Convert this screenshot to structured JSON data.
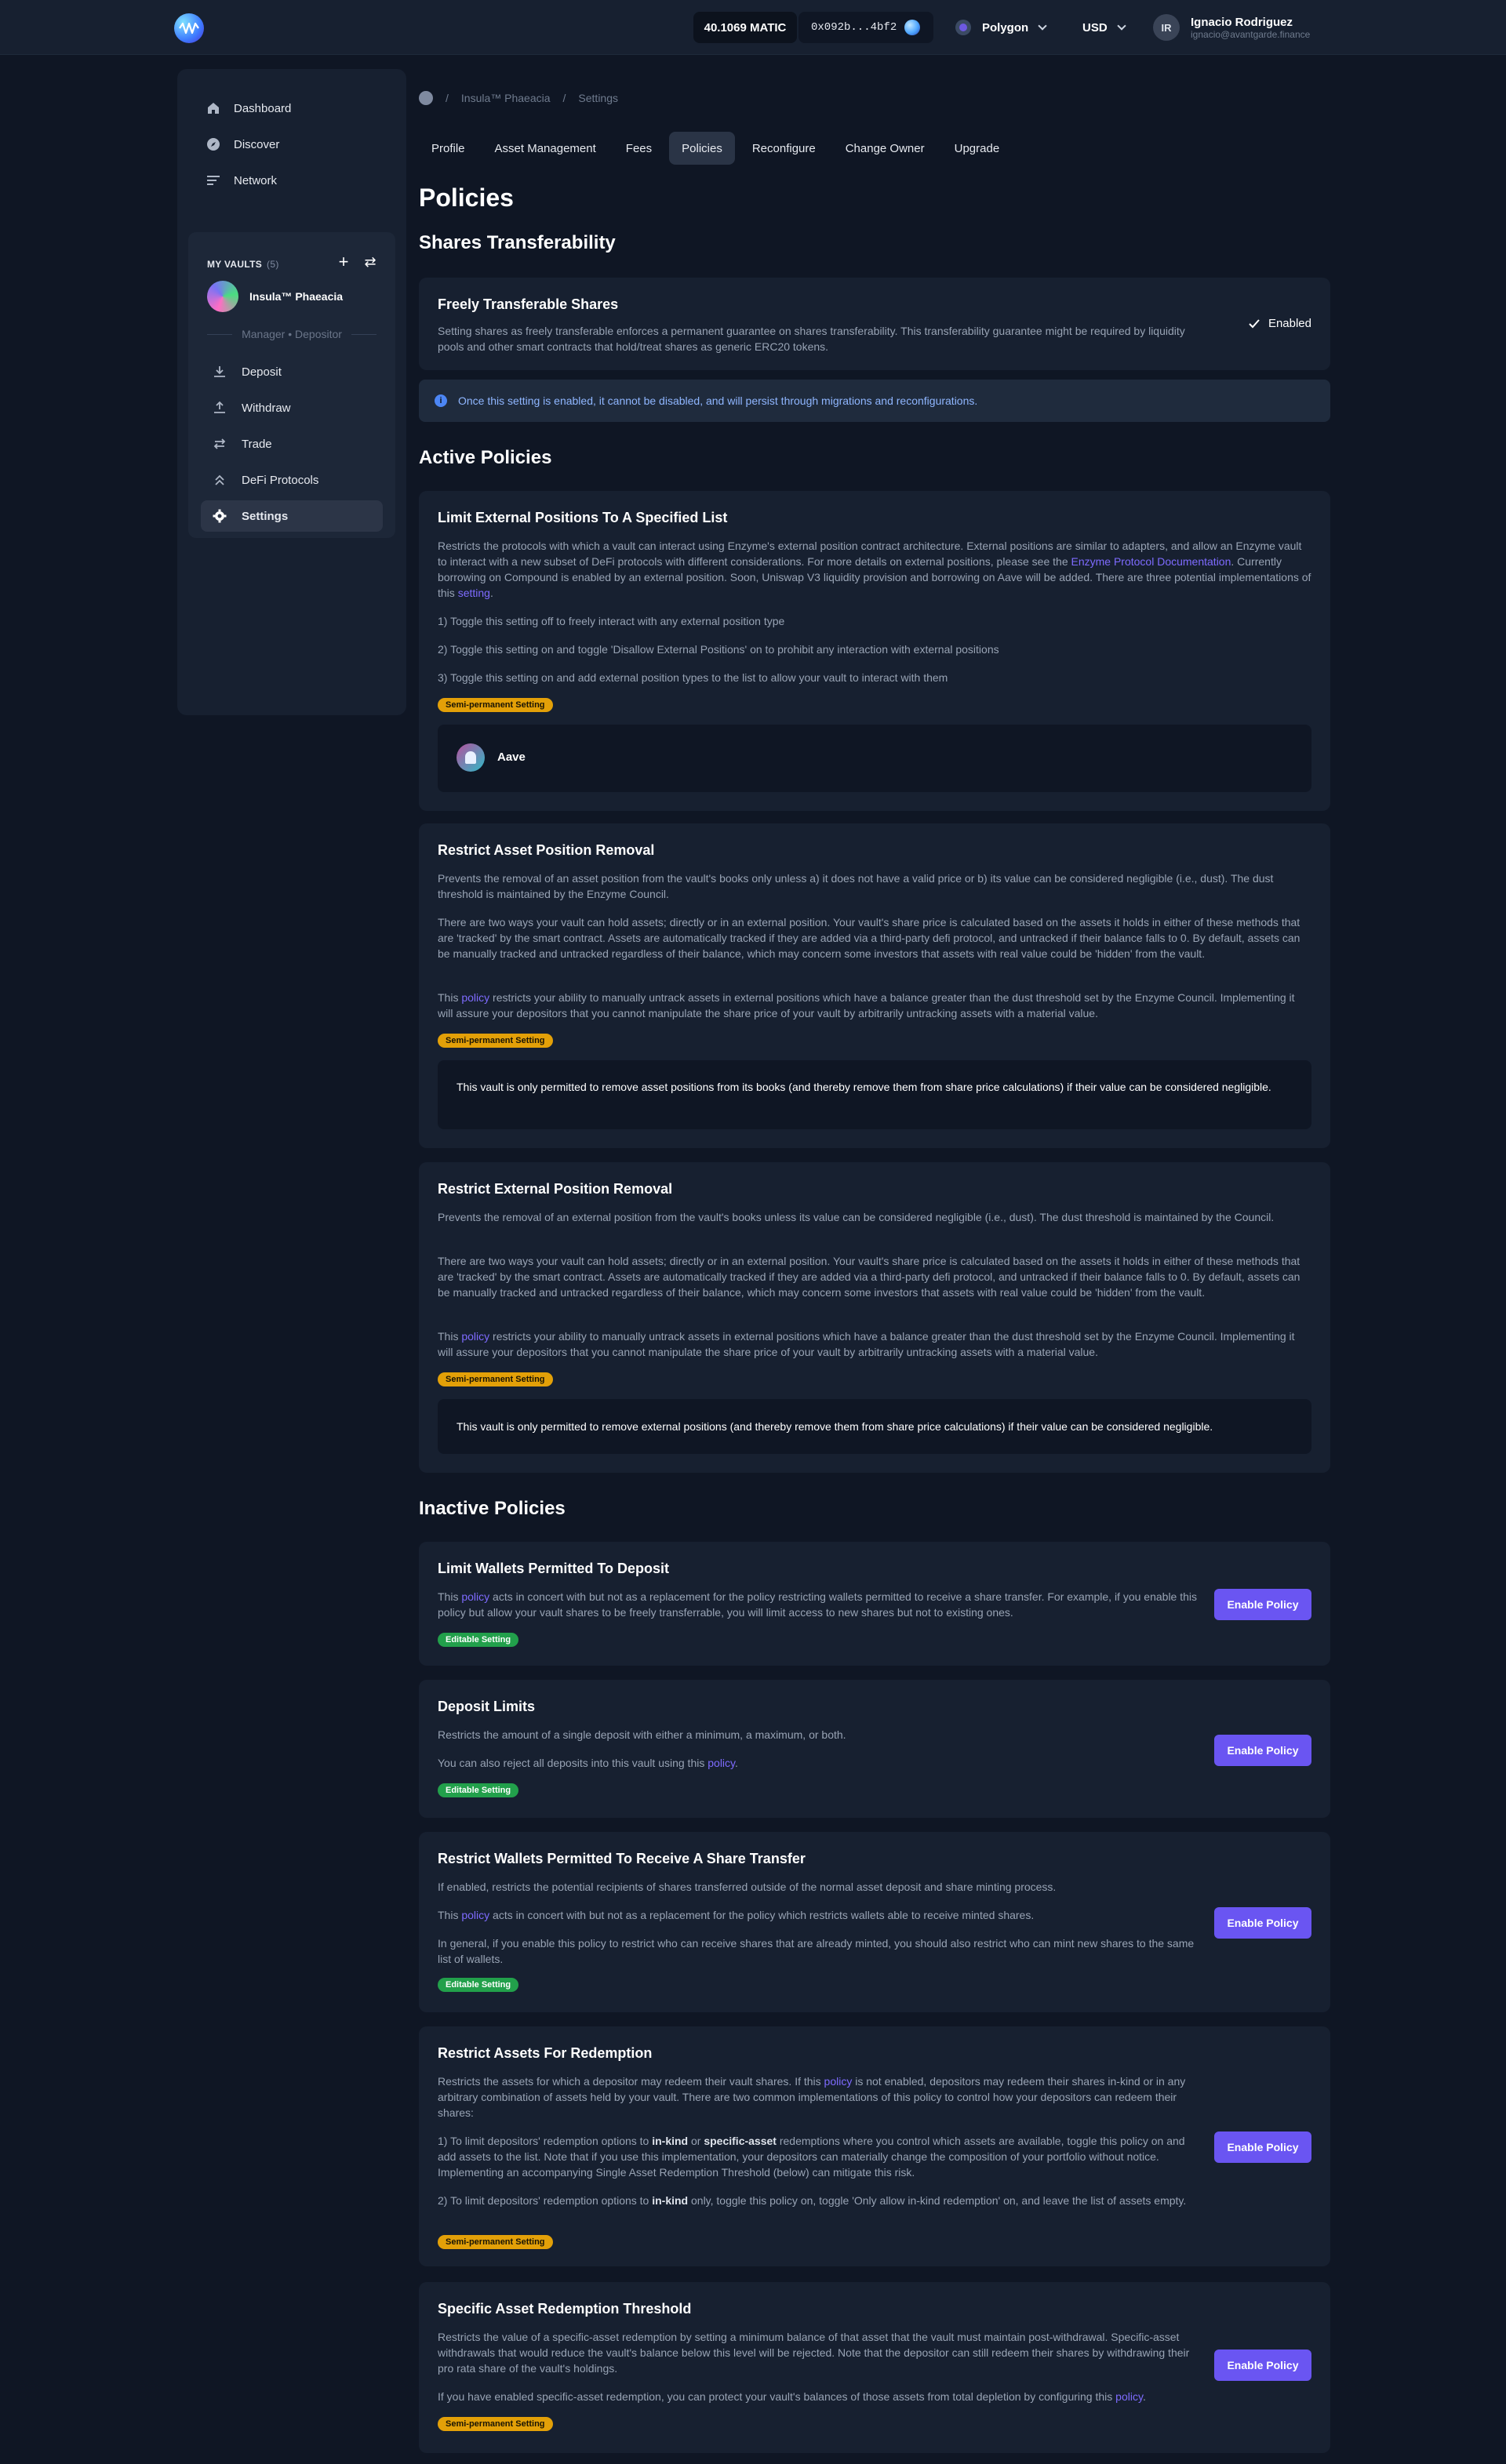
{
  "topbar": {
    "balance": "40.1069 MATIC",
    "address": "0x092b...4bf2",
    "network": "Polygon",
    "currency": "USD",
    "user_initials": "IR",
    "user_name": "Ignacio Rodriguez",
    "user_email": "ignacio@avantgarde.finance"
  },
  "sidebar": {
    "nav": [
      {
        "label": "Dashboard",
        "icon": "home-icon"
      },
      {
        "label": "Discover",
        "icon": "compass-icon"
      },
      {
        "label": "Network",
        "icon": "list-icon"
      }
    ],
    "vaults_title": "MY VAULTS",
    "vaults_count": "(5)",
    "vault_name": "Insula™ Phaeacia",
    "vault_role": "Manager • Depositor",
    "vault_items": [
      {
        "label": "Deposit",
        "icon": "download-icon"
      },
      {
        "label": "Withdraw",
        "icon": "upload-icon"
      },
      {
        "label": "Trade",
        "icon": "swap-icon"
      },
      {
        "label": "DeFi Protocols",
        "icon": "chevrons-up-icon"
      },
      {
        "label": "Settings",
        "icon": "gear-icon"
      }
    ]
  },
  "breadcrumb": [
    "Insula™ Phaeacia",
    "Settings"
  ],
  "tabs": [
    "Profile",
    "Asset Management",
    "Fees",
    "Policies",
    "Reconfigure",
    "Change Owner",
    "Upgrade"
  ],
  "page_title": "Policies",
  "shares_transferability": {
    "section_title": "Shares Transferability",
    "card_title": "Freely Transferable Shares",
    "card_text": "Setting shares as freely transferable enforces a permanent guarantee on shares transferability. This transferability guarantee might be required by liquidity pools and other smart contracts that hold/treat shares as generic ERC20 tokens.",
    "status": "Enabled",
    "info": "Once this setting is enabled, it cannot be disabled, and will persist through migrations and reconfigurations."
  },
  "active": {
    "section_title": "Active Policies",
    "limit_external": {
      "title": "Limit External Positions To A Specified List",
      "text1_a": "Restricts the protocols with which a vault can interact using Enzyme's external position contract architecture. External positions are similar to adapters, and allow an Enzyme vault to interact with a new subset of DeFi protocols with different considerations. For more details on external positions, please see the ",
      "text1_link": "Enzyme Protocol Documentation",
      "text1_b": ". Currently borrowing on Compound is enabled by an external position. Soon, Uniswap V3 liquidity provision and borrowing on Aave will be added. There are three potential implementations of this ",
      "text1_link2": "setting",
      "text1_c": ".",
      "opt1": "1) Toggle this setting off to freely interact with any external position type",
      "opt2": "2) Toggle this setting on and toggle 'Disallow External Positions' on to prohibit any interaction with external positions",
      "opt3": "3) Toggle this setting on and add external position types to the list to allow your vault to interact with them",
      "badge": "Semi-permanent Setting",
      "item": "Aave"
    },
    "restrict_asset": {
      "title": "Restrict Asset Position Removal",
      "text1": "Prevents the removal of an asset position from the vault's books only unless a) it does not have a valid price or b) its value can be considered negligible (i.e., dust). The dust threshold is maintained by the Enzyme Council.",
      "text2": "There are two ways your vault can hold assets; directly or in an external position. Your vault's share price is calculated based on the assets it holds in either of these methods that are 'tracked' by the smart contract. Assets are automatically tracked if they are added via a third-party defi protocol, and untracked if their balance falls to 0. By default, assets can be manually tracked and untracked regardless of their balance, which may concern some investors that assets with real value could be 'hidden' from the vault.",
      "text3_a": "This ",
      "text3_link": "policy",
      "text3_b": " restricts your ability to manually untrack assets in external positions which have a balance greater than the dust threshold set by the Enzyme Council. Implementing it will assure your depositors that you cannot manipulate the share price of your vault by arbitrarily untracking assets with a material value.",
      "badge": "Semi-permanent Setting",
      "box": "This vault is only permitted to remove asset positions from its books (and thereby remove them from share price calculations) if their value can be considered negligible."
    },
    "restrict_external": {
      "title": "Restrict External Position Removal",
      "text1": "Prevents the removal of an external position from the vault's books unless its value can be considered negligible (i.e., dust). The dust threshold is maintained by the Council.",
      "text2": "There are two ways your vault can hold assets; directly or in an external position. Your vault's share price is calculated based on the assets it holds in either of these methods that are 'tracked' by the smart contract. Assets are automatically tracked if they are added via a third-party defi protocol, and untracked if their balance falls to 0. By default, assets can be manually tracked and untracked regardless of their balance, which may concern some investors that assets with real value could be 'hidden' from the vault.",
      "text3_a": "This ",
      "text3_link": "policy",
      "text3_b": " restricts your ability to manually untrack assets in external positions which have a balance greater than the dust threshold set by the Enzyme Council. Implementing it will assure your depositors that you cannot manipulate the share price of your vault by arbitrarily untracking assets with a material value.",
      "badge": "Semi-permanent Setting",
      "box": "This vault is only permitted to remove external positions (and thereby remove them from share price calculations) if their value can be considered negligible."
    }
  },
  "inactive": {
    "section_title": "Inactive Policies",
    "enable_label": "Enable Policy",
    "limit_wallets": {
      "title": "Limit Wallets Permitted To Deposit",
      "text_a": "This ",
      "text_link": "policy",
      "text_b": " acts in concert with but not as a replacement for the policy restricting wallets permitted to receive a share transfer. For example, if you enable this policy but allow your vault shares to be freely transferrable, you will limit access to new shares but not to existing ones.",
      "badge": "Editable Setting"
    },
    "deposit_limits": {
      "title": "Deposit Limits",
      "text1": "Restricts the amount of a single deposit with either a minimum, a maximum, or both.",
      "text2_a": "You can also reject all deposits into this vault using this ",
      "text2_link": "policy",
      "text2_b": ".",
      "badge": "Editable Setting"
    },
    "restrict_wallets": {
      "title": "Restrict Wallets Permitted To Receive A Share Transfer",
      "text1": "If enabled, restricts the potential recipients of shares transferred outside of the normal asset deposit and share minting process.",
      "text2_a": "This ",
      "text2_link": "policy",
      "text2_b": " acts in concert with but not as a replacement for the policy which restricts wallets able to receive minted shares.",
      "text3": "In general, if you enable this policy to restrict who can receive shares that are already minted, you should also restrict who can mint new shares to the same list of wallets.",
      "badge": "Editable Setting"
    },
    "restrict_assets": {
      "title": "Restrict Assets For Redemption",
      "text1_a": "Restricts the assets for which a depositor may redeem their vault shares. If this ",
      "text1_link": "policy",
      "text1_b": " is not enabled, depositors may redeem their shares in-kind or in any arbitrary combination of assets held by your vault. There are two common implementations of this policy to control how your depositors can redeem their shares:",
      "text2_a": "1) To limit depositors' redemption options to ",
      "text2_b1": "in-kind",
      "text2_mid": " or ",
      "text2_b2": "specific-asset",
      "text2_c": " redemptions where you control which assets are available, toggle this policy on and add assets to the list. Note that if you use this implementation, your depositors can materially change the composition of your portfolio without notice. Implementing an accompanying Single Asset Redemption Threshold (below) can mitigate this risk.",
      "text3_a": "2) To limit depositors' redemption options to ",
      "text3_b": "in-kind",
      "text3_c": " only, toggle this policy on, toggle 'Only allow in-kind redemption' on, and leave the list of assets empty.",
      "badge": "Semi-permanent Setting"
    },
    "specific_threshold": {
      "title": "Specific Asset Redemption Threshold",
      "text1": "Restricts the value of a specific-asset redemption by setting a minimum balance of that asset that the vault must maintain post-withdrawal. Specific-asset withdrawals that would reduce the vault's balance below this level will be rejected. Note that the depositor can still redeem their shares by withdrawing their pro rata share of the vault's holdings.",
      "text2_a": "If you have enabled specific-asset redemption, you can protect your vault's balances of those assets from total depletion by configuring this ",
      "text2_link": "policy",
      "text2_b": ".",
      "badge": "Semi-permanent Setting"
    }
  }
}
